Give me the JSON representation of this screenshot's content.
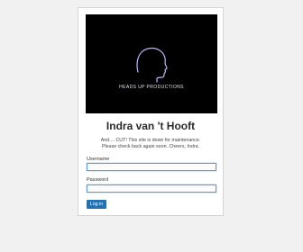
{
  "page": {
    "title": "Indra van 't Hooft",
    "banner_brand": "HEADS UP PRODUCTIONS",
    "message_lines": [
      "And.... CUT! This site is down for maintenance.",
      "Please check back again soon. Cheers, Indra."
    ]
  },
  "form": {
    "username_label": "Username",
    "username_value": "",
    "password_label": "Password",
    "password_value": "",
    "login_label": "Log in"
  },
  "colors": {
    "background": "#f1f1f1",
    "banner_bg": "#000000",
    "accent": "#2271b1",
    "input_focus_border": "#5b9dd9"
  },
  "icons": {
    "logo": "head-silhouette-icon"
  }
}
